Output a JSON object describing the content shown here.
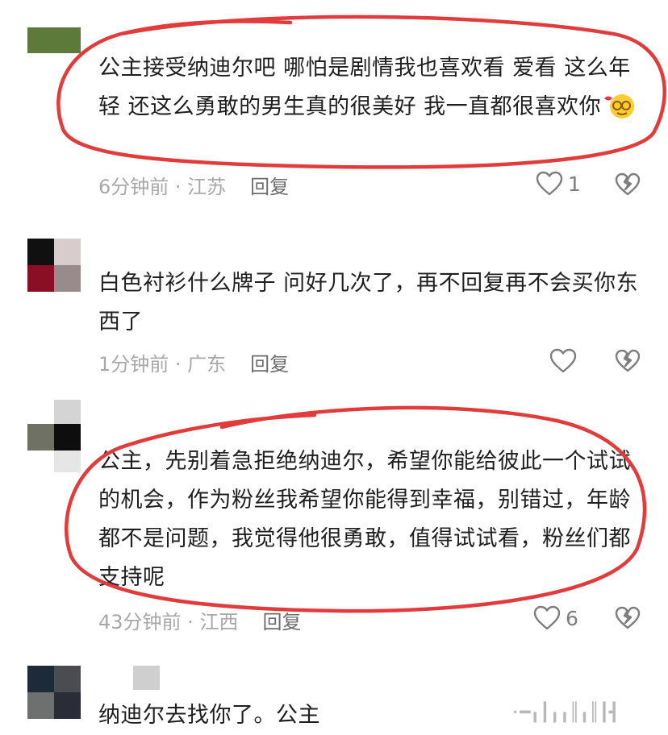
{
  "comments": [
    {
      "text": "公主接受纳迪尔吧 哪怕是剧情我也喜欢看 爱看 这么年轻 还这么勇敢的男生真的很美好 我一直都很喜欢你",
      "emoji": "smiling-face-with-eyeglasses-and-heart-emoji",
      "time": "6分钟前",
      "location": "江苏",
      "reply_label": "回复",
      "likes": "1",
      "avatar_colors": [
        "#5e7a3a",
        "#6f8c47"
      ]
    },
    {
      "text": "白色衬衫什么牌子 问好几次了，再不回复再不会买你东西了",
      "time": "1分钟前",
      "location": "广东",
      "reply_label": "回复",
      "likes": "",
      "avatar_colors": [
        "#101010",
        "#d9cccc",
        "#8a0f25",
        "#998a8c"
      ]
    },
    {
      "text": "公主，先别着急拒绝纳迪尔，希望你能给彼此一个试试的机会，作为粉丝我希望你能得到幸福，别错过，年龄都不是问题，我觉得他很勇敢，值得试试看，粉丝们都支持呢",
      "time": "43分钟前",
      "location": "江西",
      "reply_label": "回复",
      "likes": "6",
      "avatar_colors": [
        "#d4d4d4",
        "#6f7263",
        "#0e0e0e",
        "#e6e6e6"
      ]
    },
    {
      "text": "纳迪尔去找你了。公主",
      "avatar_colors": [
        "#1d2a38",
        "#4a4c52",
        "#6e7070",
        "#2a2d38",
        "#cfcfcf"
      ]
    }
  ],
  "separator": " · ",
  "annotation_color": "#e23b3b",
  "icons": {
    "like": "heart-outline-icon",
    "dislike": "broken-heart-icon"
  }
}
